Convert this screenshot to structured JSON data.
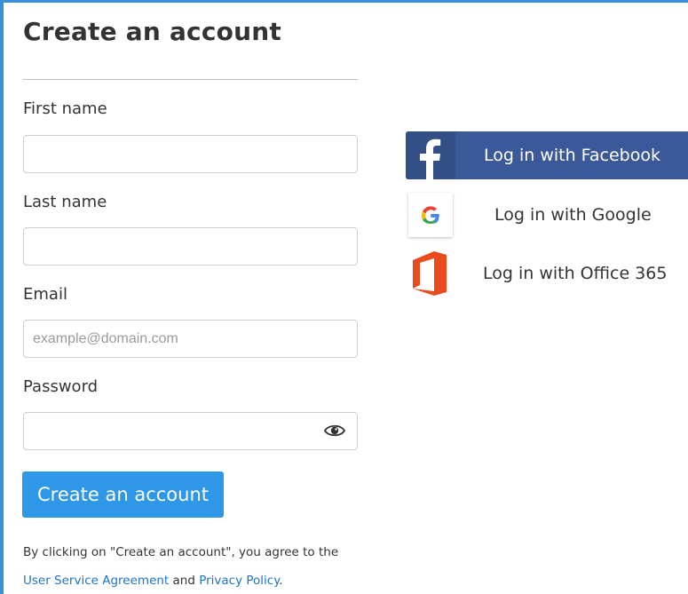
{
  "form": {
    "title": "Create an account",
    "first_name": {
      "label": "First name",
      "value": "",
      "placeholder": ""
    },
    "last_name": {
      "label": "Last name",
      "value": "",
      "placeholder": ""
    },
    "email": {
      "label": "Email",
      "value": "",
      "placeholder": "example@domain.com"
    },
    "password": {
      "label": "Password",
      "value": "",
      "placeholder": ""
    },
    "submit_label": "Create an account",
    "terms": {
      "prefix": "By clicking on \"Create an account\", you agree to the",
      "user_agreement": "User Service Agreement",
      "conjunction": " and ",
      "privacy_policy": "Privacy Policy",
      "suffix": "."
    }
  },
  "social": {
    "facebook": {
      "label": "Log in with Facebook",
      "icon": "facebook-icon",
      "color": "#3b5998"
    },
    "google": {
      "label": "Log in with Google",
      "icon": "google-icon"
    },
    "office365": {
      "label": "Log in with Office 365",
      "icon": "office365-icon",
      "color": "#e94b1c"
    }
  },
  "colors": {
    "accent": "#2f97e8",
    "frame_border": "#3a8fdc",
    "link": "#1e73c8"
  }
}
